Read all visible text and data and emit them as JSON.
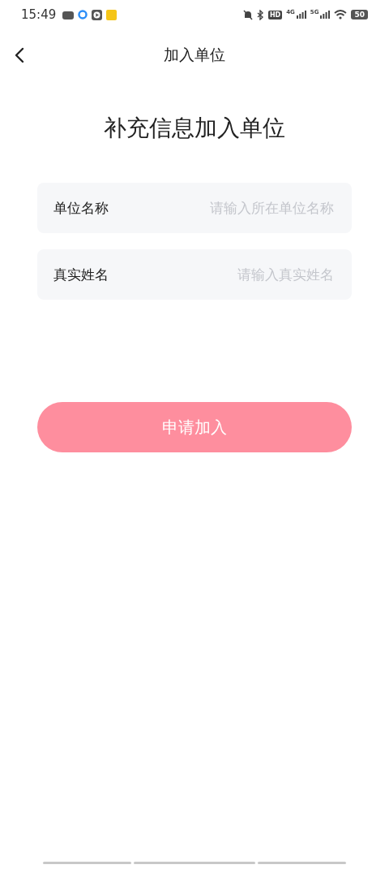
{
  "status_bar": {
    "time": "15:49",
    "network_1": "4G",
    "network_2": "5G",
    "hd": "HD",
    "battery": "50"
  },
  "nav": {
    "title": "加入单位"
  },
  "heading": "补充信息加入单位",
  "fields": [
    {
      "label": "单位名称",
      "placeholder": "请输入所在单位名称"
    },
    {
      "label": "真实姓名",
      "placeholder": "请输入真实姓名"
    }
  ],
  "submit": {
    "label": "申请加入",
    "disabled": true
  }
}
